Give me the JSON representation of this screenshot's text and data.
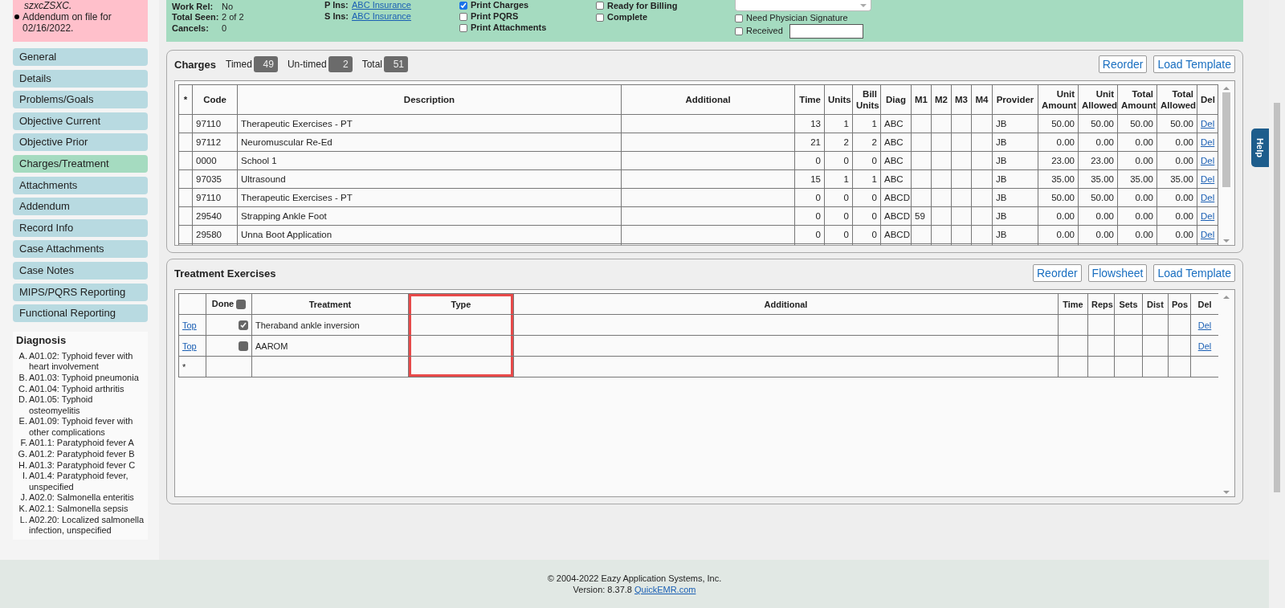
{
  "note_box": {
    "lines": [
      {
        "kind": "plain",
        "text": "szxcZSXC."
      },
      {
        "kind": "bullet",
        "text": "Addendum on file for 02/16/2022."
      }
    ]
  },
  "summary": {
    "fields": [
      {
        "label": "Work Rel:",
        "value": "No"
      },
      {
        "label": "Total Seen:",
        "value": "2 of 2"
      },
      {
        "label": "Cancels:",
        "value": "0"
      }
    ],
    "insurance": [
      {
        "label": "P Ins:",
        "link": "ABC Insurance"
      },
      {
        "label": "S Ins:",
        "link": "ABC Insurance"
      }
    ],
    "print_options": [
      {
        "label": "Print Charges",
        "checked": true
      },
      {
        "label": "Print PQRS",
        "checked": false
      },
      {
        "label": "Print Attachments",
        "checked": false
      }
    ],
    "status_options": [
      {
        "label": "Ready for Billing",
        "checked": false
      },
      {
        "label": "Complete",
        "checked": false
      }
    ],
    "signature_options": [
      {
        "label": "Need Physician Signature",
        "checked": false
      },
      {
        "label": "Received",
        "checked": false
      }
    ]
  },
  "sidebar": {
    "items": [
      {
        "label": "General",
        "selected": false
      },
      {
        "label": "Details",
        "selected": false
      },
      {
        "label": "Problems/Goals",
        "selected": false
      },
      {
        "label": "Objective Current",
        "selected": false
      },
      {
        "label": "Objective Prior",
        "selected": false
      },
      {
        "label": "Charges/Treatment",
        "selected": true
      },
      {
        "label": "Attachments",
        "selected": false
      },
      {
        "label": "Addendum",
        "selected": false
      },
      {
        "label": "Record Info",
        "selected": false
      },
      {
        "label": "Case Attachments",
        "selected": false
      },
      {
        "label": "Case Notes",
        "selected": false
      },
      {
        "label": "MIPS/PQRS Reporting",
        "selected": false
      },
      {
        "label": "Functional Reporting",
        "selected": false
      }
    ]
  },
  "diagnosis": {
    "title": "Diagnosis",
    "items": [
      {
        "letter": "A.",
        "text": "A01.02: Typhoid fever with heart involvement"
      },
      {
        "letter": "B.",
        "text": "A01.03: Typhoid pneumonia"
      },
      {
        "letter": "C.",
        "text": "A01.04: Typhoid arthritis"
      },
      {
        "letter": "D.",
        "text": "A01.05: Typhoid osteomyelitis"
      },
      {
        "letter": "E.",
        "text": "A01.09: Typhoid fever with other complications"
      },
      {
        "letter": "F.",
        "text": "A01.1: Paratyphoid fever A"
      },
      {
        "letter": "G.",
        "text": "A01.2: Paratyphoid fever B"
      },
      {
        "letter": "H.",
        "text": "A01.3: Paratyphoid fever C"
      },
      {
        "letter": "I.",
        "text": "A01.4: Paratyphoid fever, unspecified"
      },
      {
        "letter": "J.",
        "text": "A02.0: Salmonella enteritis"
      },
      {
        "letter": "K.",
        "text": "A02.1: Salmonella sepsis"
      },
      {
        "letter": "L.",
        "text": "A02.20: Localized salmonella infection, unspecified"
      }
    ]
  },
  "charges": {
    "title": "Charges",
    "counters": [
      {
        "label": "Timed",
        "value": "49"
      },
      {
        "label": "Un-timed",
        "value": "2"
      },
      {
        "label": "Total",
        "value": "51"
      }
    ],
    "buttons": [
      "Reorder",
      "Load Template"
    ],
    "columns": [
      {
        "label": "*"
      },
      {
        "label": "Code"
      },
      {
        "label": "Description"
      },
      {
        "label": "Additional"
      },
      {
        "label": "Time"
      },
      {
        "label": "Units"
      },
      {
        "label": "Bill Units"
      },
      {
        "label": "Diag"
      },
      {
        "label": "M1"
      },
      {
        "label": "M2"
      },
      {
        "label": "M3"
      },
      {
        "label": "M4"
      },
      {
        "label": "Provider"
      },
      {
        "label": "Unit Amount"
      },
      {
        "label": "Unit Allowed"
      },
      {
        "label": "Total Amount"
      },
      {
        "label": "Total Allowed"
      },
      {
        "label": "Del"
      }
    ],
    "rows": [
      {
        "code": "97110",
        "description": "Therapeutic Exercises - PT",
        "time": "13",
        "units": "1",
        "bill_units": "1",
        "diag": "ABC",
        "unit_amount": "50.00",
        "unit_allowed": "50.00",
        "total_amount": "50.00",
        "total_allowed": "50.00",
        "provider": "JB",
        "del": "Del"
      },
      {
        "code": "97112",
        "description": "Neuromuscular Re-Ed",
        "time": "21",
        "units": "2",
        "bill_units": "2",
        "diag": "ABC",
        "unit_amount": "0.00",
        "unit_allowed": "0.00",
        "total_amount": "0.00",
        "total_allowed": "0.00",
        "provider": "JB",
        "del": "Del"
      },
      {
        "code": "0000",
        "description": "School 1",
        "time": "0",
        "units": "0",
        "bill_units": "0",
        "diag": "ABC",
        "unit_amount": "23.00",
        "unit_allowed": "23.00",
        "total_amount": "0.00",
        "total_allowed": "0.00",
        "provider": "JB",
        "del": "Del"
      },
      {
        "code": "97035",
        "description": "Ultrasound",
        "time": "15",
        "units": "1",
        "bill_units": "1",
        "diag": "ABC",
        "unit_amount": "35.00",
        "unit_allowed": "35.00",
        "total_amount": "35.00",
        "total_allowed": "35.00",
        "provider": "JB",
        "del": "Del"
      },
      {
        "code": "97110",
        "description": "Therapeutic Exercises - PT",
        "time": "0",
        "units": "0",
        "bill_units": "0",
        "diag": "ABCD",
        "unit_amount": "50.00",
        "unit_allowed": "50.00",
        "total_amount": "0.00",
        "total_allowed": "0.00",
        "provider": "JB",
        "del": "Del"
      },
      {
        "code": "29540",
        "description": "Strapping Ankle Foot",
        "time": "0",
        "units": "0",
        "bill_units": "0",
        "diag": "ABCD",
        "m1": "59",
        "unit_amount": "0.00",
        "unit_allowed": "0.00",
        "total_amount": "0.00",
        "total_allowed": "0.00",
        "provider": "JB",
        "del": "Del"
      },
      {
        "code": "29580",
        "description": "Unna Boot Application",
        "time": "0",
        "units": "0",
        "bill_units": "0",
        "diag": "ABCD",
        "unit_amount": "0.00",
        "unit_allowed": "0.00",
        "total_amount": "0.00",
        "total_allowed": "0.00",
        "provider": "JB",
        "del": "Del"
      }
    ]
  },
  "treatment": {
    "title": "Treatment Exercises",
    "buttons": [
      "Reorder",
      "Flowsheet",
      "Load Template"
    ],
    "columns": [
      {
        "highlighted": false
      },
      {
        "label": "Done",
        "highlighted": false
      },
      {
        "label": "Treatment",
        "highlighted": false
      },
      {
        "label": "Type",
        "highlighted": true
      },
      {
        "label": "Additional",
        "highlighted": false
      },
      {
        "label": "Time",
        "highlighted": false
      },
      {
        "label": "Reps",
        "highlighted": false
      },
      {
        "label": "Sets",
        "highlighted": false
      },
      {
        "label": "Dist",
        "highlighted": false
      },
      {
        "label": "Pos",
        "highlighted": false
      },
      {
        "label": "Del",
        "highlighted": false
      }
    ],
    "done_all": false,
    "rows": [
      {
        "kind": "item",
        "top": "Top",
        "done": true,
        "treatment": "Theraband ankle inversion",
        "del": "Del"
      },
      {
        "kind": "item",
        "top": "Top",
        "done": false,
        "treatment": "AAROM",
        "del": "Del"
      },
      {
        "kind": "new",
        "marker": "*"
      }
    ]
  },
  "help_tab": "Help",
  "footer": {
    "copyright": "© 2004-2022 Eazy Application Systems, Inc.",
    "version": "Version: 8.37.8",
    "link": "QuickEMR.com"
  }
}
